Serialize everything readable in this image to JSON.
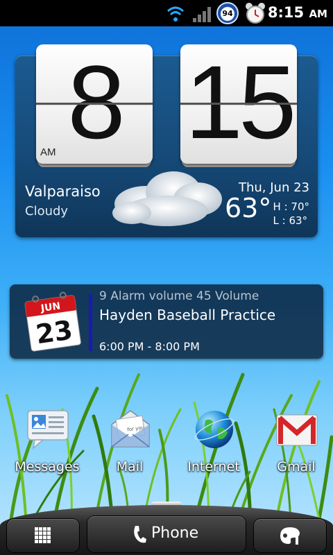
{
  "status_bar": {
    "time": "8:15",
    "ampm": "AM",
    "battery_level": "94",
    "icons": [
      "wifi-icon",
      "signal-icon",
      "battery-icon",
      "alarm-icon"
    ]
  },
  "clock_widget": {
    "hour": "8",
    "minutes": "15",
    "ampm": "AM",
    "city": "Valparaiso",
    "condition": "Cloudy",
    "date": "Thu, Jun 23",
    "temperature": "63°",
    "high": "H : 70°",
    "low": "L : 63°"
  },
  "calendar_widget": {
    "icon_month": "JUN",
    "icon_day": "23",
    "status_line": "9 Alarm volume 45 Volume",
    "event_title": "Hayden Baseball Practice",
    "event_time": "6:00 PM - 8:00 PM",
    "event_color": "#1a1ab0"
  },
  "apps": [
    {
      "label": "Messages",
      "icon": "messages-icon"
    },
    {
      "label": "Mail",
      "icon": "mail-icon"
    },
    {
      "label": "Internet",
      "icon": "internet-icon"
    },
    {
      "label": "Gmail",
      "icon": "gmail-icon"
    }
  ],
  "dock": {
    "phone_label": "Phone"
  }
}
